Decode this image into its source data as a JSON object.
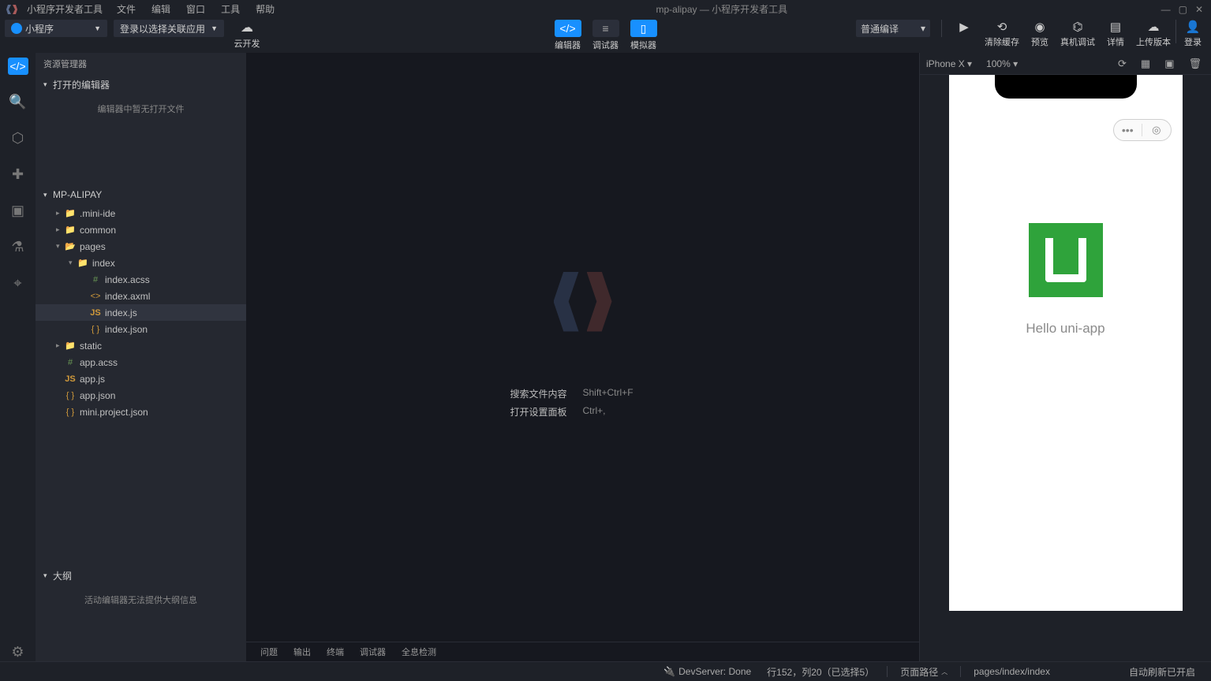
{
  "titlebar": {
    "app_name": "小程序开发者工具",
    "menus": [
      "文件",
      "编辑",
      "窗口",
      "工具",
      "帮助"
    ],
    "window_title": "mp-alipay — 小程序开发者工具"
  },
  "toolbar": {
    "program_dd": "小程序",
    "login_dd": "登录以选择关联应用",
    "cloud_label": "云开发",
    "center_tabs": [
      {
        "label": "编辑器",
        "active": true
      },
      {
        "label": "调试器",
        "active": false
      },
      {
        "label": "模拟器",
        "active": true
      }
    ],
    "compile_dd": "普通编译",
    "right_buttons": [
      "清除缓存",
      "预览",
      "真机调试",
      "详情",
      "上传版本",
      "登录"
    ]
  },
  "explorer": {
    "title": "资源管理器",
    "open_editors_label": "打开的编辑器",
    "no_open_files": "编辑器中暂无打开文件",
    "project_name": "MP-ALIPAY",
    "outline_label": "大纲",
    "outline_empty": "活动编辑器无法提供大纲信息",
    "tree": [
      {
        "type": "folder",
        "name": ".mini-ide",
        "depth": 1,
        "open": false
      },
      {
        "type": "folder",
        "name": "common",
        "depth": 1,
        "open": false
      },
      {
        "type": "folder",
        "name": "pages",
        "depth": 1,
        "open": true
      },
      {
        "type": "folder-y",
        "name": "index",
        "depth": 2,
        "open": true
      },
      {
        "type": "hash",
        "name": "index.acss",
        "depth": 3
      },
      {
        "type": "tag",
        "name": "index.axml",
        "depth": 3
      },
      {
        "type": "js",
        "name": "index.js",
        "depth": 3,
        "selected": true
      },
      {
        "type": "json",
        "name": "index.json",
        "depth": 3
      },
      {
        "type": "folder",
        "name": "static",
        "depth": 1,
        "open": false
      },
      {
        "type": "hash",
        "name": "app.acss",
        "depth": 1
      },
      {
        "type": "js",
        "name": "app.js",
        "depth": 1
      },
      {
        "type": "json",
        "name": "app.json",
        "depth": 1
      },
      {
        "type": "json",
        "name": "mini.project.json",
        "depth": 1
      }
    ]
  },
  "editor": {
    "hint1_label": "搜索文件内容",
    "hint1_keys": "Shift+Ctrl+F",
    "hint2_label": "打开设置面板",
    "hint2_keys": "Ctrl+,",
    "bottom_tabs": [
      "问题",
      "输出",
      "终端",
      "调试器",
      "全息检测"
    ]
  },
  "simulator": {
    "device": "iPhone X",
    "zoom": "100%",
    "app_text": "Hello uni-app"
  },
  "statusbar": {
    "devserver": "DevServer: Done",
    "cursor": "行152，列20（已选择5）",
    "page_path_label": "页面路径",
    "page_path": "pages/index/index",
    "auto_refresh": "自动刷新已开启"
  }
}
